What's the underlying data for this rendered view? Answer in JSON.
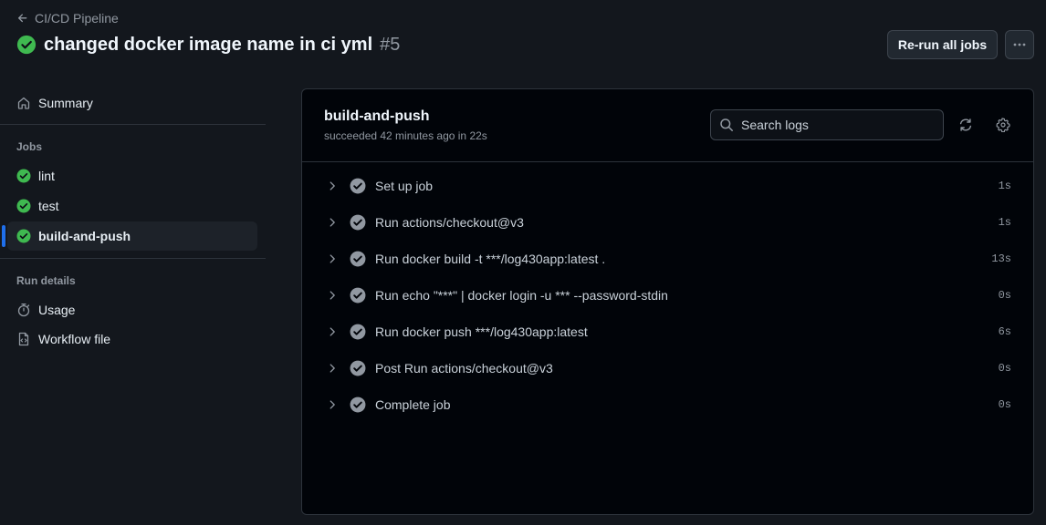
{
  "header": {
    "back_label": "CI/CD Pipeline",
    "title": "changed docker image name in ci yml",
    "run_number": "#5",
    "rerun_label": "Re-run all jobs",
    "more_icon": "kebab-horizontal-icon"
  },
  "sidebar": {
    "summary_label": "Summary",
    "jobs_heading": "Jobs",
    "jobs": [
      {
        "label": "lint",
        "status": "success"
      },
      {
        "label": "test",
        "status": "success"
      },
      {
        "label": "build-and-push",
        "status": "success",
        "active": true
      }
    ],
    "run_details_heading": "Run details",
    "usage_label": "Usage",
    "workflow_file_label": "Workflow file"
  },
  "job": {
    "title": "build-and-push",
    "subtitle": "succeeded 42 minutes ago in 22s",
    "search_placeholder": "Search logs",
    "steps": [
      {
        "label": "Set up job",
        "duration": "1s"
      },
      {
        "label": "Run actions/checkout@v3",
        "duration": "1s"
      },
      {
        "label": "Run docker build -t ***/log430app:latest .",
        "duration": "13s"
      },
      {
        "label": "Run echo \"***\" | docker login -u *** --password-stdin",
        "duration": "0s"
      },
      {
        "label": "Run docker push ***/log430app:latest",
        "duration": "6s"
      },
      {
        "label": "Post Run actions/checkout@v3",
        "duration": "0s"
      },
      {
        "label": "Complete job",
        "duration": "0s"
      }
    ]
  },
  "colors": {
    "background": "#13171d",
    "panel": "#010409",
    "success": "#3fb950",
    "step_check": "#9198a1",
    "active_indicator": "#1f6feb"
  }
}
